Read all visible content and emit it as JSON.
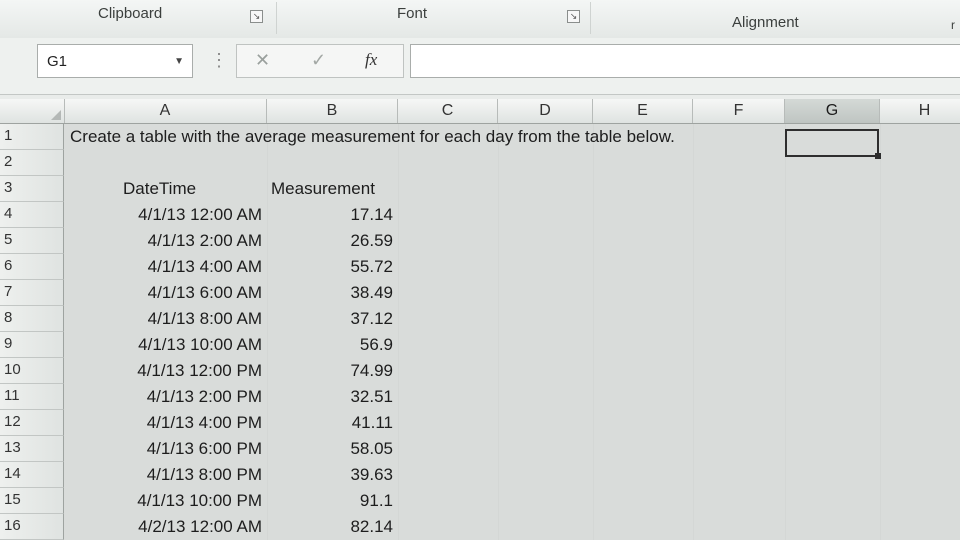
{
  "ribbon": {
    "groups": [
      {
        "label": "Clipboard"
      },
      {
        "label": "Font"
      },
      {
        "label": "Alignment"
      }
    ],
    "edge_char": "r"
  },
  "formula_bar": {
    "name_box": "G1",
    "cancel_glyph": "✕",
    "enter_glyph": "✓",
    "fx_label": "fx",
    "formula_value": ""
  },
  "columns": [
    "A",
    "B",
    "C",
    "D",
    "E",
    "F",
    "G",
    "H"
  ],
  "selected_column": "G",
  "selected_cell": "G1",
  "rows": [
    {
      "num": "1",
      "a": "Create a table with the average measurement for each day from the table below.",
      "b": ""
    },
    {
      "num": "2",
      "a": "",
      "b": ""
    },
    {
      "num": "3",
      "a": "DateTime",
      "b": "Measurement"
    },
    {
      "num": "4",
      "a": "4/1/13 12:00 AM",
      "b": "17.14"
    },
    {
      "num": "5",
      "a": "4/1/13 2:00 AM",
      "b": "26.59"
    },
    {
      "num": "6",
      "a": "4/1/13 4:00 AM",
      "b": "55.72"
    },
    {
      "num": "7",
      "a": "4/1/13 6:00 AM",
      "b": "38.49"
    },
    {
      "num": "8",
      "a": "4/1/13 8:00 AM",
      "b": "37.12"
    },
    {
      "num": "9",
      "a": "4/1/13 10:00 AM",
      "b": "56.9"
    },
    {
      "num": "10",
      "a": "4/1/13 12:00 PM",
      "b": "74.99"
    },
    {
      "num": "11",
      "a": "4/1/13 2:00 PM",
      "b": "32.51"
    },
    {
      "num": "12",
      "a": "4/1/13 4:00 PM",
      "b": "41.11"
    },
    {
      "num": "13",
      "a": "4/1/13 6:00 PM",
      "b": "58.05"
    },
    {
      "num": "14",
      "a": "4/1/13 8:00 PM",
      "b": "39.63"
    },
    {
      "num": "15",
      "a": "4/1/13 10:00 PM",
      "b": "91.1"
    },
    {
      "num": "16",
      "a": "4/2/13 12:00 AM",
      "b": "82.14"
    }
  ]
}
